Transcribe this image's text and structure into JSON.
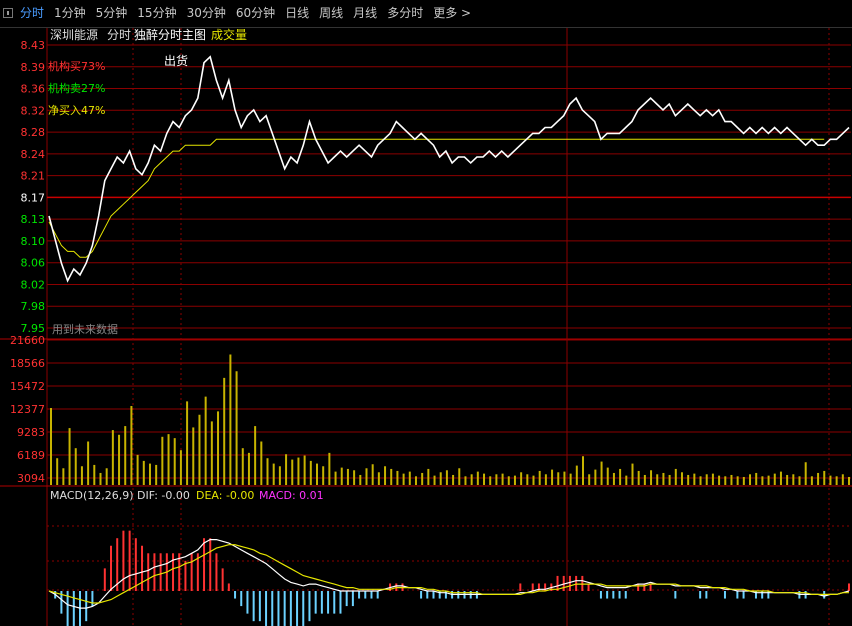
{
  "tabs": [
    "分时",
    "1分钟",
    "5分钟",
    "15分钟",
    "30分钟",
    "60分钟",
    "日线",
    "周线",
    "月线",
    "多分时",
    "更多 >"
  ],
  "active_tab": 0,
  "header": {
    "stock_name": "深圳能源",
    "mode_label": "分时",
    "main_indicator": "独醉分时主图",
    "volume_label": "成交量"
  },
  "overlay": {
    "inst_buy": "机构买73%",
    "inst_sell": "机构卖27%",
    "net_buy": "净买入47%",
    "sell_marker": "出货",
    "future_data_note": "用到未来数据"
  },
  "price_axis": {
    "labels": [
      "8.43",
      "8.39",
      "8.36",
      "8.32",
      "8.28",
      "8.24",
      "8.21",
      "8.17",
      "8.13",
      "8.10",
      "8.06",
      "8.02",
      "7.98",
      "7.95"
    ],
    "ref_price": "8.17"
  },
  "volume_axis": {
    "labels": [
      "21660",
      "18566",
      "15472",
      "12377",
      "9283",
      "6189",
      "3094"
    ]
  },
  "macd": {
    "label": "MACD(12,26,9)",
    "dif": "DIF: -0.00",
    "dea": "DEA: -0.00",
    "macd": "MACD: 0.01"
  },
  "colors": {
    "up": "#ff3232",
    "down": "#00e600",
    "grid": "#8b0000",
    "price_line": "#ffffff",
    "avg_line": "#e6e600",
    "volume_bar": "#c8b400",
    "macd_pos": "#ff3232",
    "macd_neg": "#6cd2ff",
    "macd_label": "#ff33ff"
  },
  "chart_data": {
    "type": "line",
    "price_ylim": [
      7.95,
      8.43
    ],
    "series": [
      {
        "values": [
          8.14,
          8.1,
          8.06,
          8.03,
          8.05,
          8.04,
          8.06,
          8.09,
          8.14,
          8.2,
          8.22,
          8.24,
          8.23,
          8.25,
          8.22,
          8.21,
          8.23,
          8.26,
          8.25,
          8.28,
          8.3,
          8.29,
          8.31,
          8.32,
          8.34,
          8.4,
          8.41,
          8.37,
          8.34,
          8.37,
          8.32,
          8.29,
          8.31,
          8.32,
          8.3,
          8.31,
          8.28,
          8.25,
          8.22,
          8.24,
          8.23,
          8.26,
          8.3,
          8.27,
          8.25,
          8.23,
          8.24,
          8.25,
          8.24,
          8.25,
          8.26,
          8.25,
          8.24,
          8.26,
          8.27,
          8.28,
          8.3,
          8.29,
          8.28,
          8.27,
          8.28,
          8.27,
          8.26,
          8.24,
          8.25,
          8.23,
          8.24,
          8.24,
          8.23,
          8.24,
          8.24,
          8.25,
          8.24,
          8.25,
          8.24,
          8.25,
          8.26,
          8.27,
          8.28,
          8.28,
          8.29,
          8.29,
          8.3,
          8.31,
          8.33,
          8.34,
          8.32,
          8.31,
          8.3,
          8.27,
          8.28,
          8.28,
          8.28,
          8.29,
          8.3,
          8.32,
          8.33,
          8.34,
          8.33,
          8.32,
          8.33,
          8.31,
          8.32,
          8.33,
          8.32,
          8.31,
          8.32,
          8.31,
          8.32,
          8.3,
          8.3,
          8.29,
          8.28,
          8.29,
          8.28,
          8.29,
          8.28,
          8.29,
          8.28,
          8.29,
          8.28,
          8.27,
          8.26,
          8.27,
          8.26,
          8.26,
          8.27,
          8.27,
          8.28,
          8.29
        ]
      },
      {
        "values": [
          8.13,
          8.11,
          8.09,
          8.08,
          8.08,
          8.07,
          8.07,
          8.08,
          8.1,
          8.12,
          8.14,
          8.15,
          8.16,
          8.17,
          8.18,
          8.19,
          8.2,
          8.22,
          8.23,
          8.24,
          8.25,
          8.25,
          8.26,
          8.26,
          8.26,
          8.26,
          8.26,
          8.27,
          8.27,
          8.27,
          8.27,
          8.27,
          8.27,
          8.27,
          8.27,
          8.27,
          8.27,
          8.27,
          8.27,
          8.27,
          8.27,
          8.27,
          8.27,
          8.27,
          8.27,
          8.27,
          8.27,
          8.27,
          8.27,
          8.27,
          8.27,
          8.27,
          8.27,
          8.27,
          8.27,
          8.27,
          8.27,
          8.27,
          8.27,
          8.27,
          8.27,
          8.27,
          8.27,
          8.27,
          8.27,
          8.27,
          8.27,
          8.27,
          8.27,
          8.27,
          8.27,
          8.27,
          8.27,
          8.27,
          8.27,
          8.27,
          8.27,
          8.27,
          8.27,
          8.27,
          8.27,
          8.27,
          8.27,
          8.27,
          8.27,
          8.27,
          8.27,
          8.27,
          8.27,
          8.27,
          8.27,
          8.27,
          8.27,
          8.27,
          8.27,
          8.27,
          8.27,
          8.27,
          8.27,
          8.27,
          8.27,
          8.27,
          8.27,
          8.27,
          8.27,
          8.27,
          8.27,
          8.27,
          8.27,
          8.27,
          8.27,
          8.27,
          8.27,
          8.27,
          8.27,
          8.27,
          8.27,
          8.27,
          8.27,
          8.27,
          8.27,
          8.27,
          8.27,
          8.27,
          8.27,
          8.27
        ]
      }
    ],
    "volume_ylim": [
      0,
      21660
    ],
    "volume": [
      11500,
      4000,
      2500,
      8500,
      5500,
      2800,
      6500,
      3000,
      1800,
      2500,
      8200,
      7500,
      8800,
      11800,
      4500,
      3600,
      3200,
      3000,
      7200,
      7600,
      7000,
      5200,
      12500,
      8600,
      10500,
      13200,
      9500,
      11000,
      16000,
      19500,
      17000,
      5500,
      4800,
      8800,
      6500,
      4000,
      3200,
      2800,
      4600,
      3800,
      4100,
      4400,
      3600,
      3200,
      2800,
      4800,
      2000,
      2600,
      2400,
      2200,
      1500,
      2500,
      3100,
      1900,
      2800,
      2400,
      2100,
      1700,
      2000,
      1300,
      1800,
      2400,
      1400,
      1900,
      2200,
      1500,
      2500,
      1300,
      1600,
      2000,
      1700,
      1300,
      1600,
      1700,
      1300,
      1400,
      1900,
      1600,
      1400,
      2100,
      1600,
      2300,
      1900,
      2000,
      1700,
      2900,
      4300,
      1600,
      2300,
      3500,
      2600,
      1800,
      2400,
      1400,
      3200,
      2100,
      1500,
      2200,
      1600,
      1800,
      1500,
      2400,
      1900,
      1500,
      1700,
      1300,
      1600,
      1700,
      1400,
      1300,
      1500,
      1300,
      1200,
      1600,
      1800,
      1300,
      1400,
      1700,
      2000,
      1500,
      1600,
      1300,
      3400,
      1300,
      1800,
      2100,
      1400,
      1300,
      1600,
      1200
    ],
    "macd_dif": [
      0.0,
      -0.002,
      -0.005,
      -0.008,
      -0.009,
      -0.01,
      -0.01,
      -0.009,
      -0.007,
      -0.003,
      0.001,
      0.004,
      0.007,
      0.009,
      0.01,
      0.011,
      0.012,
      0.014,
      0.015,
      0.016,
      0.018,
      0.019,
      0.02,
      0.022,
      0.024,
      0.028,
      0.03,
      0.03,
      0.029,
      0.028,
      0.026,
      0.024,
      0.022,
      0.02,
      0.018,
      0.016,
      0.013,
      0.01,
      0.007,
      0.005,
      0.004,
      0.003,
      0.004,
      0.004,
      0.003,
      0.002,
      0.001,
      0.0,
      0.0,
      0.0,
      0.0,
      0.0,
      0.0,
      0.0,
      0.001,
      0.002,
      0.003,
      0.003,
      0.002,
      0.002,
      0.001,
      0.0,
      0.0,
      -0.001,
      -0.001,
      -0.002,
      -0.002,
      -0.002,
      -0.002,
      -0.002,
      -0.002,
      -0.002,
      -0.002,
      -0.002,
      -0.002,
      -0.002,
      -0.001,
      -0.001,
      0.0,
      0.001,
      0.001,
      0.002,
      0.003,
      0.004,
      0.005,
      0.006,
      0.006,
      0.005,
      0.004,
      0.003,
      0.002,
      0.002,
      0.002,
      0.002,
      0.003,
      0.004,
      0.004,
      0.005,
      0.004,
      0.004,
      0.004,
      0.003,
      0.003,
      0.003,
      0.003,
      0.002,
      0.002,
      0.002,
      0.002,
      0.001,
      0.001,
      0.0,
      0.0,
      0.0,
      -0.001,
      -0.001,
      -0.001,
      -0.001,
      -0.001,
      -0.001,
      -0.001,
      -0.002,
      -0.002,
      -0.002,
      -0.002,
      -0.003,
      -0.002,
      -0.002,
      -0.001,
      0.0
    ],
    "macd_dea": [
      0.0,
      -0.001,
      -0.002,
      -0.003,
      -0.004,
      -0.005,
      -0.006,
      -0.007,
      -0.007,
      -0.006,
      -0.005,
      -0.003,
      -0.001,
      0.001,
      0.003,
      0.005,
      0.007,
      0.009,
      0.01,
      0.011,
      0.013,
      0.014,
      0.016,
      0.017,
      0.019,
      0.021,
      0.023,
      0.025,
      0.026,
      0.027,
      0.027,
      0.026,
      0.025,
      0.024,
      0.022,
      0.021,
      0.019,
      0.017,
      0.015,
      0.013,
      0.011,
      0.009,
      0.008,
      0.007,
      0.006,
      0.005,
      0.004,
      0.003,
      0.002,
      0.002,
      0.001,
      0.001,
      0.001,
      0.001,
      0.001,
      0.001,
      0.002,
      0.002,
      0.002,
      0.002,
      0.002,
      0.001,
      0.001,
      0.0,
      0.0,
      -0.001,
      -0.001,
      -0.001,
      -0.001,
      -0.001,
      -0.002,
      -0.002,
      -0.002,
      -0.002,
      -0.002,
      -0.002,
      -0.002,
      -0.001,
      -0.001,
      0.0,
      0.0,
      0.001,
      0.001,
      0.002,
      0.003,
      0.004,
      0.004,
      0.004,
      0.004,
      0.004,
      0.003,
      0.003,
      0.003,
      0.003,
      0.003,
      0.003,
      0.003,
      0.004,
      0.004,
      0.004,
      0.004,
      0.004,
      0.003,
      0.003,
      0.003,
      0.003,
      0.003,
      0.002,
      0.002,
      0.002,
      0.001,
      0.001,
      0.001,
      0.0,
      0.0,
      0.0,
      0.0,
      -0.001,
      -0.001,
      -0.001,
      -0.001,
      -0.001,
      -0.001,
      -0.002,
      -0.002,
      -0.002,
      -0.002,
      -0.002,
      -0.001,
      -0.001
    ],
    "macd_ylim": [
      -0.035,
      0.035
    ]
  }
}
